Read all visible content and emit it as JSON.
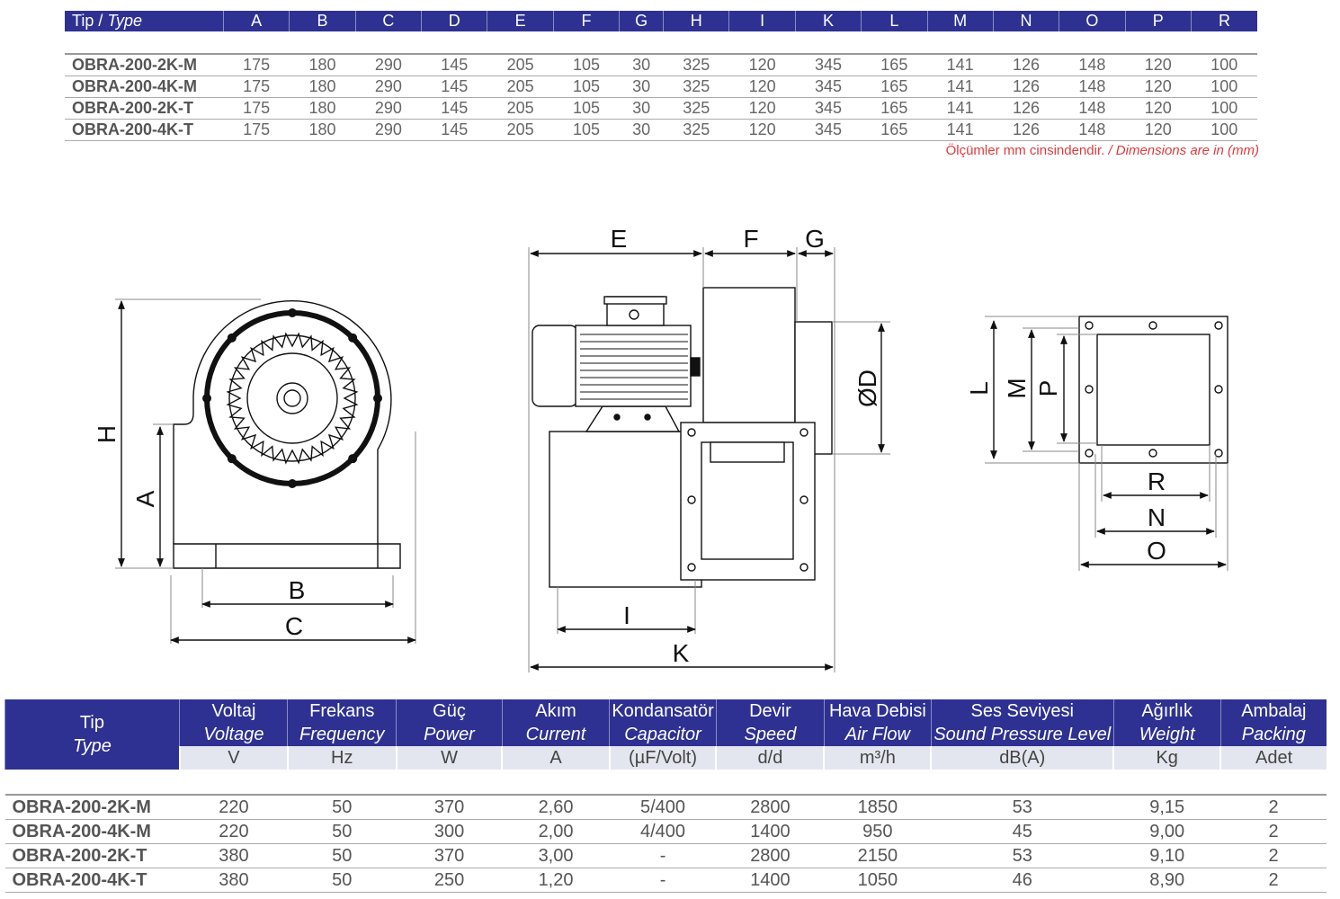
{
  "dimensions_table": {
    "type_header": "Tip / ",
    "type_header_italic": "Type",
    "columns": [
      "A",
      "B",
      "C",
      "D",
      "E",
      "F",
      "G",
      "H",
      "I",
      "K",
      "L",
      "M",
      "N",
      "O",
      "P",
      "R"
    ],
    "rows": [
      {
        "type": "OBRA-200-2K-M",
        "values": [
          "175",
          "180",
          "290",
          "145",
          "205",
          "105",
          "30",
          "325",
          "120",
          "345",
          "165",
          "141",
          "126",
          "148",
          "120",
          "100"
        ]
      },
      {
        "type": "OBRA-200-4K-M",
        "values": [
          "175",
          "180",
          "290",
          "145",
          "205",
          "105",
          "30",
          "325",
          "120",
          "345",
          "165",
          "141",
          "126",
          "148",
          "120",
          "100"
        ]
      },
      {
        "type": "OBRA-200-2K-T",
        "values": [
          "175",
          "180",
          "290",
          "145",
          "205",
          "105",
          "30",
          "325",
          "120",
          "345",
          "165",
          "141",
          "126",
          "148",
          "120",
          "100"
        ]
      },
      {
        "type": "OBRA-200-4K-T",
        "values": [
          "175",
          "180",
          "290",
          "145",
          "205",
          "105",
          "30",
          "325",
          "120",
          "345",
          "165",
          "141",
          "126",
          "148",
          "120",
          "100"
        ]
      }
    ],
    "note": "Ölçümler mm cinsindendir. ",
    "note_italic": "/ Dimensions are in (mm)"
  },
  "drawing_labels": {
    "H": "H",
    "A": "A",
    "B": "B",
    "C": "C",
    "E": "E",
    "F": "F",
    "G": "G",
    "D": "ØD",
    "I": "I",
    "K": "K",
    "L": "L",
    "M": "M",
    "P": "P",
    "R": "R",
    "N": "N",
    "O": "O"
  },
  "spec_table": {
    "columns": [
      {
        "tr": "Tip",
        "en": "Type",
        "unit": ""
      },
      {
        "tr": "Voltaj",
        "en": "Voltage",
        "unit": "V"
      },
      {
        "tr": "Frekans",
        "en": "Frequency",
        "unit": "Hz"
      },
      {
        "tr": "Güç",
        "en": "Power",
        "unit": "W"
      },
      {
        "tr": "Akım",
        "en": "Current",
        "unit": "A"
      },
      {
        "tr": "Kondansatör",
        "en": "Capacitor",
        "unit": "(µF/Volt)"
      },
      {
        "tr": "Devir",
        "en": "Speed",
        "unit": "d/d"
      },
      {
        "tr": "Hava Debisi",
        "en": "Air Flow",
        "unit": "m³/h"
      },
      {
        "tr": "Ses Seviyesi",
        "en": "Sound Pressure Level",
        "unit": "dB(A)"
      },
      {
        "tr": "Ağırlık",
        "en": "Weight",
        "unit": "Kg"
      },
      {
        "tr": "Ambalaj",
        "en": "Packing",
        "unit": "Adet"
      }
    ],
    "rows": [
      [
        "OBRA-200-2K-M",
        "220",
        "50",
        "370",
        "2,60",
        "5/400",
        "2800",
        "1850",
        "53",
        "9,15",
        "2"
      ],
      [
        "OBRA-200-4K-M",
        "220",
        "50",
        "300",
        "2,00",
        "4/400",
        "1400",
        "950",
        "45",
        "9,00",
        "2"
      ],
      [
        "OBRA-200-2K-T",
        "380",
        "50",
        "370",
        "3,00",
        "-",
        "2800",
        "2150",
        "53",
        "9,10",
        "2"
      ],
      [
        "OBRA-200-4K-T",
        "380",
        "50",
        "250",
        "1,20",
        "-",
        "1400",
        "1050",
        "46",
        "8,90",
        "2"
      ]
    ]
  },
  "colors": {
    "header": "#2e3192",
    "unit_row": "#e4e6ef",
    "note": "#e03a3e"
  }
}
